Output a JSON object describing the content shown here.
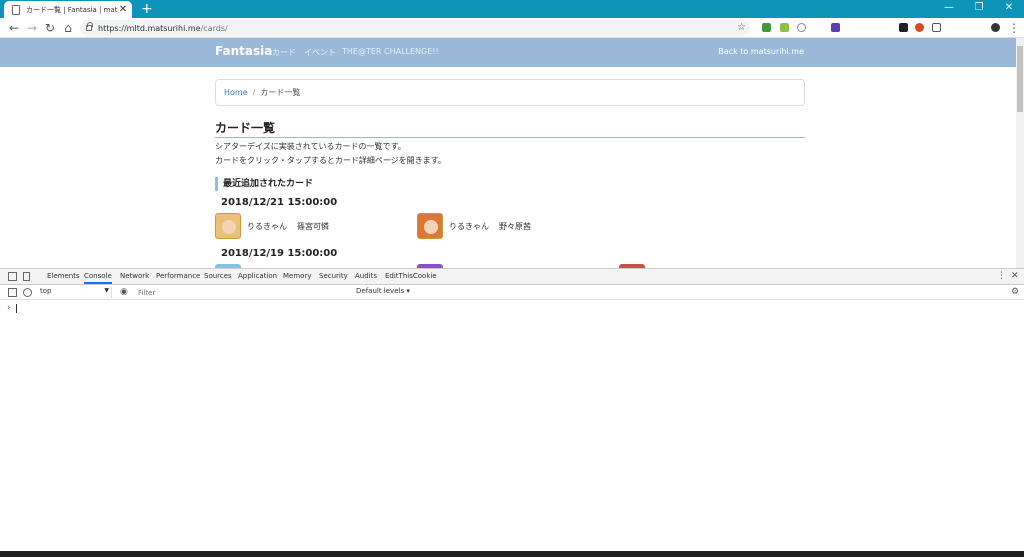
{
  "browser": {
    "tab_title": "カード一覧 | Fantasia | matsurihi.me",
    "tab_close": "✕",
    "new_tab": "+",
    "url_host": "https://mltd.matsurihi.me",
    "url_path": "/cards/",
    "window_controls": [
      "—",
      "❐",
      "✕"
    ],
    "extension_icons": [
      "extension-icon",
      "extension-icon",
      "extension-icon",
      "extension-icon",
      "extension-icon",
      "extension-icon",
      "extension-icon",
      "extension-icon"
    ]
  },
  "site": {
    "brand": "Fantasia",
    "nav_links": [
      "カード",
      "イベント",
      "THE@TER CHALLENGE!!"
    ],
    "back_link": "Back to matsurihi.me"
  },
  "breadcrumb": {
    "home": "Home",
    "separator": "/",
    "current": "カード一覧"
  },
  "page": {
    "title": "カード一覧",
    "desc1": "シアターデイズに実装されているカードの一覧です。",
    "desc2": "カードをクリック・タップするとカード詳細ページを開きます。",
    "section": "最近追加されたカード",
    "groups": [
      {
        "date": "2018/12/21 15:00:00",
        "cards": [
          {
            "name": "りるきゃん",
            "idol": "篠宮可憐",
            "color": "#e8c17a"
          },
          {
            "name": "りるきゃん",
            "idol": "野々原茜",
            "color": "#d9783a"
          }
        ]
      },
      {
        "date": "2018/12/19 15:00:00",
        "cards": []
      }
    ]
  },
  "devtools": {
    "tabs": [
      "Elements",
      "Console",
      "Network",
      "Performance",
      "Sources",
      "Application",
      "Memory",
      "Security",
      "Audits",
      "EditThisCookie"
    ],
    "active_tab": "Console",
    "context": "top",
    "filter_placeholder": "Filter",
    "levels": "Default levels ▾",
    "prompt": "›"
  }
}
